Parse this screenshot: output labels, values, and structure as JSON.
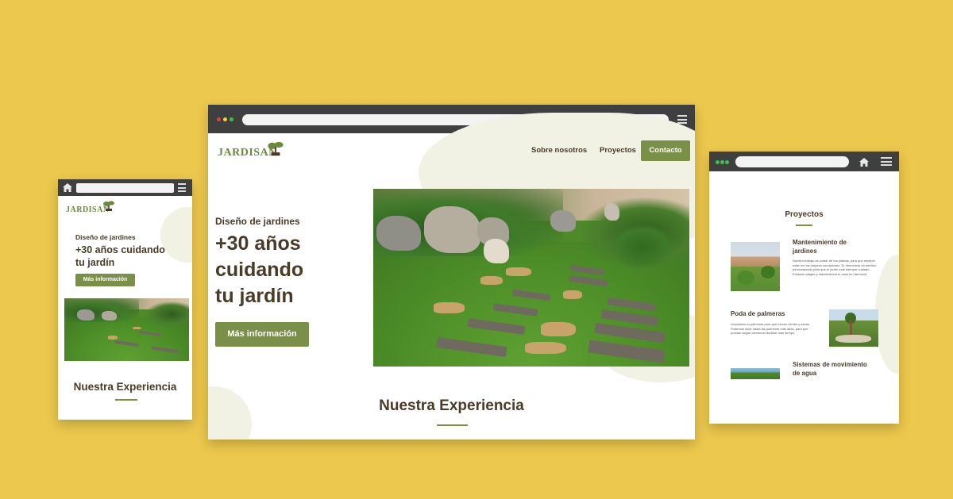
{
  "brand": {
    "name": "JARDISAN",
    "accent": "#7a8f48",
    "background": "#ECC84D",
    "text_brown": "#4a3a28"
  },
  "icons": {
    "home": "home-icon",
    "menu": "hamburger-menu-icon",
    "logo_tree": "bonsai-tree-icon"
  },
  "desktop": {
    "nav": {
      "about": "Sobre nosotros",
      "projects": "Proyectos",
      "contact": "Contacto"
    },
    "hero": {
      "kicker": "Diseño de jardines",
      "title_line1": "+30 años",
      "title_line2": "cuidando",
      "title_line3": "tu jardín",
      "button": "Más información"
    },
    "section_title": "Nuestra Experiencia"
  },
  "mobile": {
    "hero": {
      "kicker": "Diseño de jardines",
      "title_line1": "+30 años cuidando",
      "title_line2": "tu jardín",
      "button": "Más información"
    },
    "section_title": "Nuestra Experiencia"
  },
  "tablet": {
    "section_title": "Proyectos",
    "projects": [
      {
        "title_line1": "Mantenimiento de",
        "title_line2": "jardines",
        "description": "Nuestro trabajo es cuidar de tus plantas, para que siempre estén en las mejores condiciones. Te ofrecemos un servicio personalizado para que tu jardín esté siempre cuidado. Evitando plagas y manteniendo tu casa en harmonía."
      },
      {
        "title_line1": "Poda de palmeras",
        "title_line2": "",
        "description": "Limpiamos tu palmeras para que luzcan verdes y sanas. Podemos subir hasta las palmeras más altas, para que puedan seguir creciendo durante más tiempo."
      },
      {
        "title_line1": "Sistemas de movimiento",
        "title_line2": "de agua",
        "description": ""
      }
    ]
  }
}
